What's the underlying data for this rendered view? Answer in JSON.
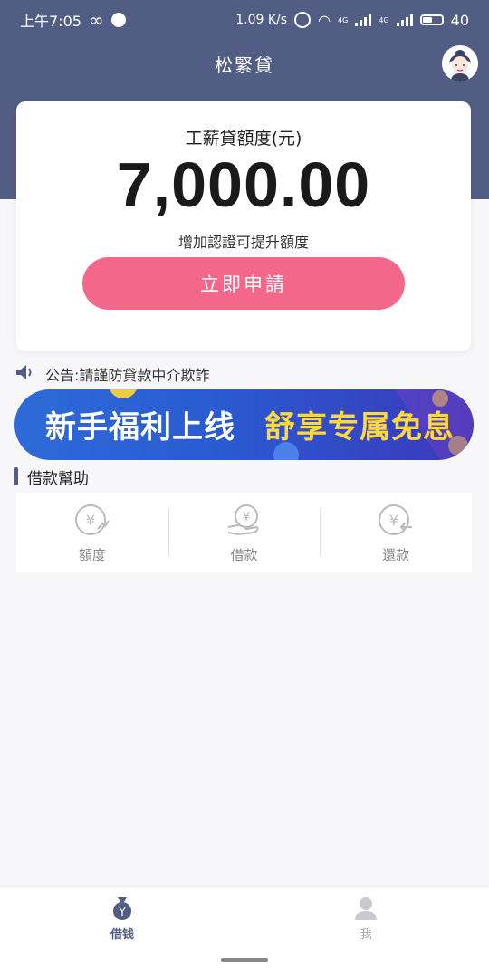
{
  "status_bar": {
    "time": "上午7:05",
    "speed": "1.09 K/s",
    "net1": "4G",
    "net2": "4G",
    "battery": "40"
  },
  "header": {
    "title": "松緊貸",
    "avatar_icon": "user-avatar-icon"
  },
  "limit_card": {
    "label": "工薪貸額度(元)",
    "amount": "7,000.00",
    "hint": "增加認證可提升額度",
    "apply_button": "立即申請"
  },
  "notice": {
    "icon": "speaker-icon",
    "text": "公告:請謹防貸款中介欺詐"
  },
  "banner": {
    "text_left": "新手福利上线",
    "text_right": "舒享专属免息"
  },
  "help": {
    "title": "借款幫助",
    "items": [
      {
        "label": "額度",
        "icon": "yen-chart-icon"
      },
      {
        "label": "借款",
        "icon": "yen-hand-icon"
      },
      {
        "label": "還款",
        "icon": "yen-return-icon"
      }
    ]
  },
  "tabbar": {
    "tabs": [
      {
        "label": "借钱",
        "icon": "loan-bag-icon",
        "active": true
      },
      {
        "label": "我",
        "icon": "profile-icon",
        "active": false
      }
    ]
  },
  "colors": {
    "primary": "#525d84",
    "accent": "#f2678a",
    "banner_yellow": "#ffd83a"
  }
}
